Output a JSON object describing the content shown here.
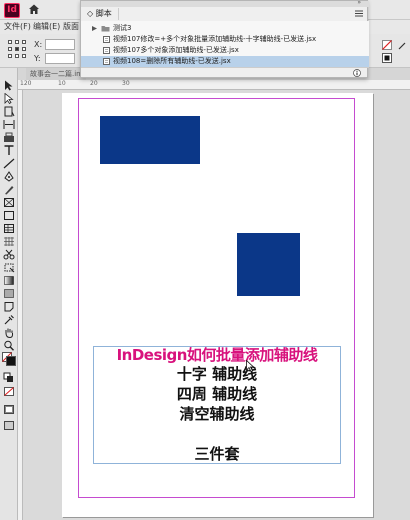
{
  "app": {
    "logo_text": "Id"
  },
  "menubar": {
    "items": [
      "文件(F)",
      "编辑(E)",
      "版面"
    ]
  },
  "controlbar": {
    "x_label": "X:",
    "y_label": "Y:"
  },
  "document": {
    "tab_label": "故事会一二篇.indd"
  },
  "ruler": {
    "ticks": [
      "120",
      "10",
      "20",
      "30"
    ]
  },
  "scripts_panel": {
    "tab_label": "脚本",
    "rows": [
      {
        "label": "测试3",
        "type": "folder",
        "selected": false
      },
      {
        "label": "视频107修改=+多个对象批量添加辅助线-十字辅助线-已发送.jsx",
        "type": "script",
        "selected": false
      },
      {
        "label": "视频107多个对象添加辅助线-已发送.jsx",
        "type": "script",
        "selected": false
      },
      {
        "label": "视频108=删除所有辅助线-已发送.jsx",
        "type": "script",
        "selected": true
      }
    ]
  },
  "page": {
    "headline": "InDesign如何批量添加辅助线",
    "lines": [
      "十字 辅助线",
      "四周 辅助线",
      "清空辅助线",
      "三件套"
    ]
  },
  "colors": {
    "accent_magenta": "#d8127d",
    "block_blue": "#0b3788",
    "margin_guide": "#c54bd0",
    "logo_bg": "#49021f",
    "logo_fg": "#ff3366"
  }
}
